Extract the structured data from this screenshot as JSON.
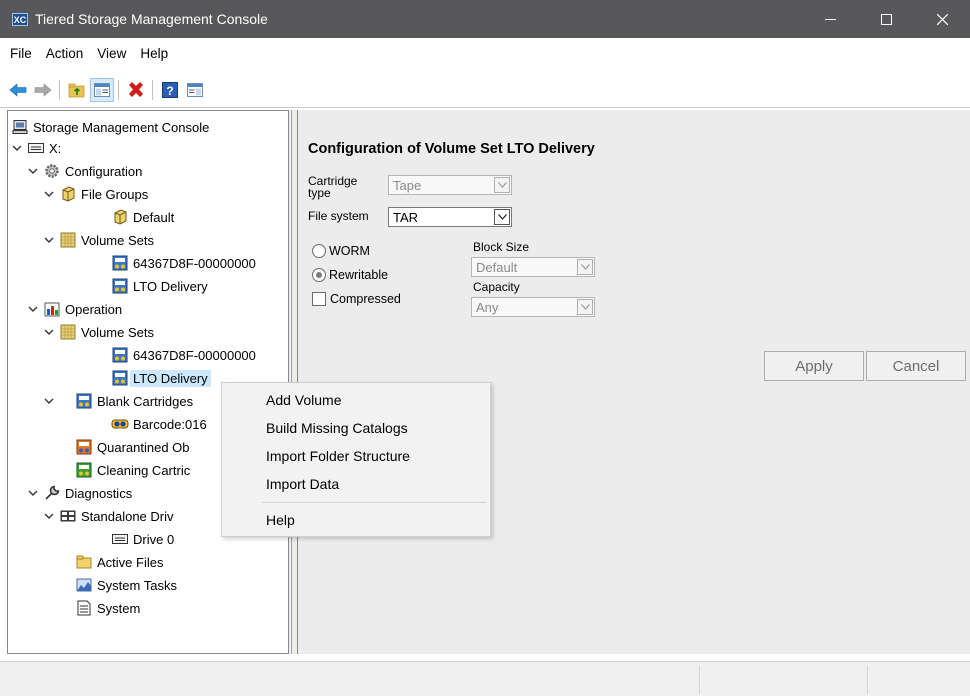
{
  "window": {
    "title": "Tiered Storage Management Console",
    "app_icon_text": "XC"
  },
  "menu": [
    "File",
    "Action",
    "View",
    "Help"
  ],
  "toolbar": [
    "back-arrow-icon",
    "forward-arrow-icon",
    "up-folder-icon",
    "show-hide-tree-icon",
    "delete-icon",
    "help-icon",
    "properties-icon"
  ],
  "tree": {
    "root": "Storage Management Console",
    "drive": "X:",
    "configuration": "Configuration",
    "file_groups": "File Groups",
    "default": "Default",
    "volume_sets": "Volume Sets",
    "vs1": "64367D8F-00000000",
    "vs2": "LTO Delivery",
    "operation": "Operation",
    "op_volume_sets": "Volume Sets",
    "op_vs1": "64367D8F-00000000",
    "op_vs2": "LTO Delivery",
    "blank_cartridges": "Blank Cartridges",
    "barcode": "Barcode:016",
    "quarantined": "Quarantined Ob",
    "cleaning": "Cleaning Cartric",
    "diagnostics": "Diagnostics",
    "standalone": "Standalone Driv",
    "drive0": "Drive 0",
    "active_files": "Active Files",
    "system_tasks": "System Tasks",
    "system": "System"
  },
  "config": {
    "title": "Configuration of Volume Set LTO Delivery",
    "cartridge_type_label": "Cartridge type",
    "cartridge_type_value": "Tape",
    "file_system_label": "File system",
    "file_system_value": "TAR",
    "worm_label": "WORM",
    "rewritable_label": "Rewritable",
    "rewritable_selected": true,
    "compressed_label": "Compressed",
    "compressed_checked": false,
    "block_size_label": "Block Size",
    "block_size_value": "Default",
    "capacity_label": "Capacity",
    "capacity_value": "Any",
    "apply_label": "Apply",
    "cancel_label": "Cancel"
  },
  "context_menu": {
    "items": [
      "Add Volume",
      "Build Missing Catalogs",
      "Import Folder Structure",
      "Import Data"
    ],
    "help": "Help"
  },
  "colors": {
    "titlebar": "#58585a",
    "selection": "#cce8ff",
    "panel_bg": "#ececec"
  }
}
